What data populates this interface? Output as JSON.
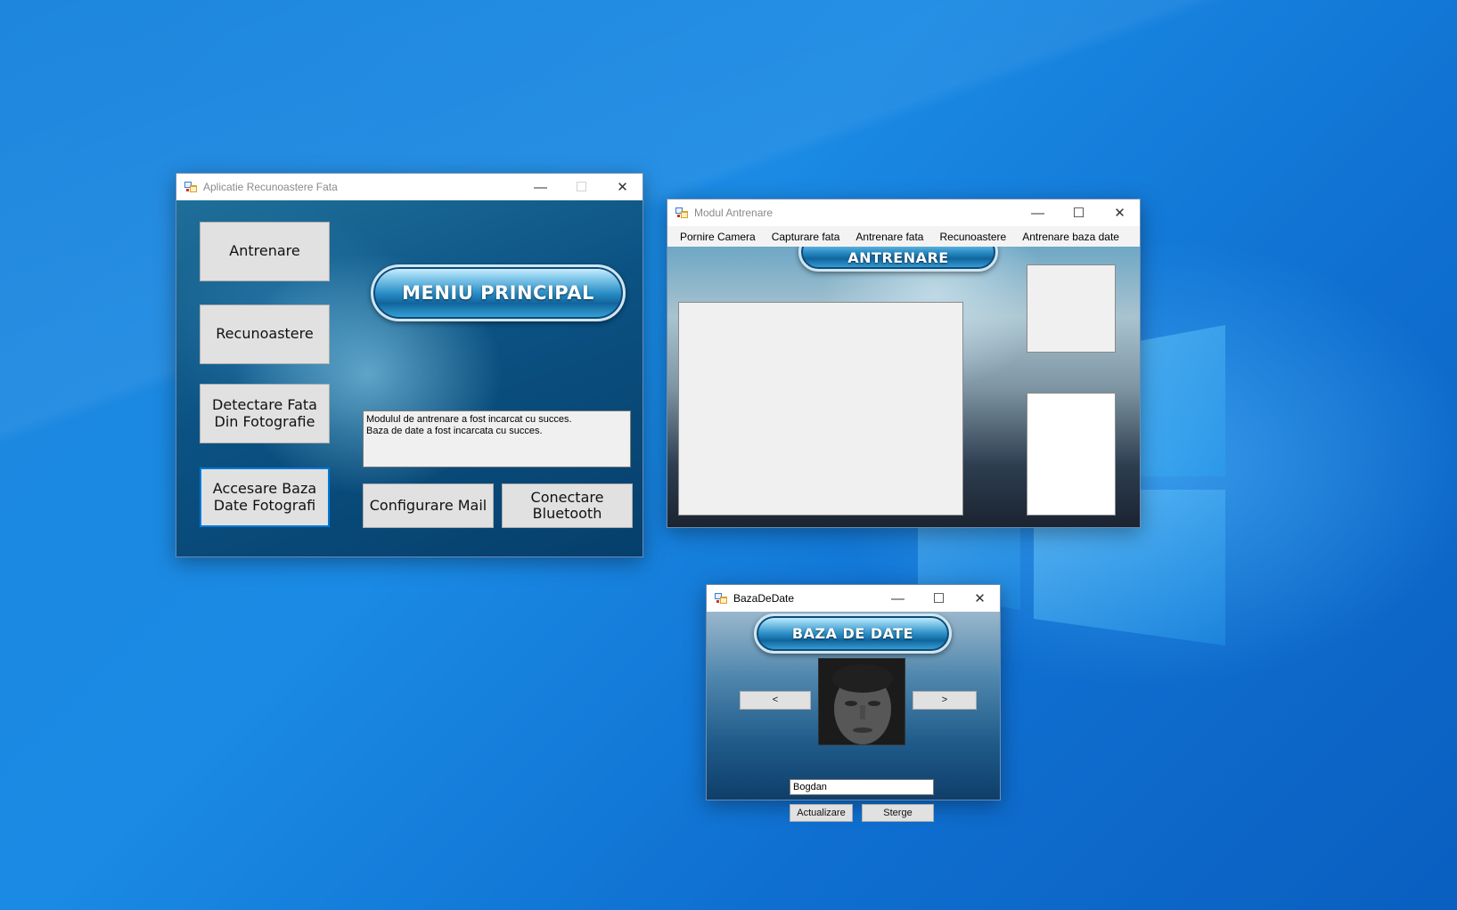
{
  "colors": {
    "accent": "#0078d7",
    "desktop": "#1a8ae4"
  },
  "icons": {
    "app": "app-window-icon",
    "minimize": "minimize-icon",
    "maximize": "maximize-icon",
    "close": "close-icon",
    "windows_logo": "windows-logo-icon"
  },
  "main_window": {
    "title": "Aplicatie Recunoastere Fata",
    "controls": {
      "minimize": "—",
      "maximize": "☐",
      "close": "✕"
    },
    "buttons": {
      "antrenare": "Antrenare",
      "recunoastere": "Recunoastere",
      "detectare": "Detectare Fata\nDin Fotografie",
      "accesare": "Accesare Baza\nDate Fotografi",
      "configurare_mail": "Configurare Mail",
      "conectare_bluetooth": "Conectare\nBluetooth"
    },
    "banner": "MENIU PRINCIPAL",
    "log_lines": [
      "Modulul de antrenare a fost incarcat cu succes.",
      "Baza de date a fost incarcata cu succes."
    ]
  },
  "training_window": {
    "title": "Modul Antrenare",
    "controls": {
      "minimize": "—",
      "maximize": "☐",
      "close": "✕"
    },
    "menu": [
      "Pornire Camera",
      "Capturare fata",
      "Antrenare fata",
      "Recunoastere",
      "Antrenare baza date"
    ],
    "banner": "ANTRENARE"
  },
  "db_window": {
    "title": "BazaDeDate",
    "controls": {
      "minimize": "—",
      "maximize": "☐",
      "close": "✕"
    },
    "banner": "BAZA DE DATE",
    "prev_label": "<",
    "next_label": ">",
    "name_value": "Bogdan",
    "update_label": "Actualizare",
    "delete_label": "Sterge"
  }
}
